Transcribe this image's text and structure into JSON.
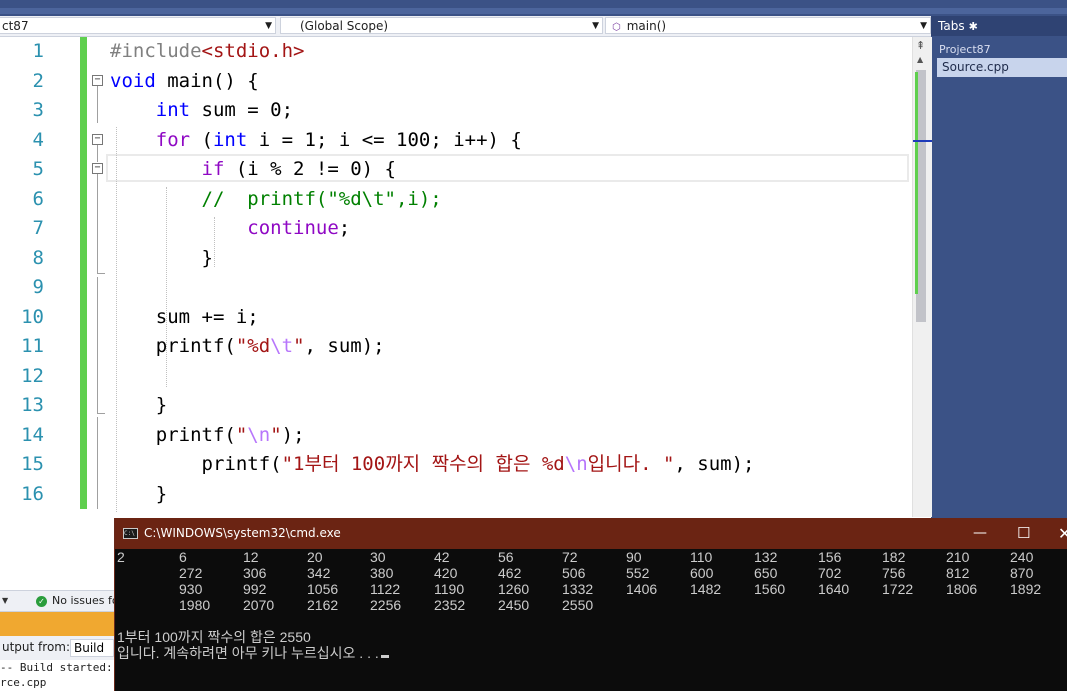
{
  "navbar": {
    "file_dropdown": "ct87",
    "scope_dropdown": "(Global Scope)",
    "function_dropdown": "main()"
  },
  "tabs_panel": {
    "title": "Tabs",
    "gear_icon": "gear-icon",
    "project": "Project87",
    "file": "Source.cpp"
  },
  "editor": {
    "line_numbers": [
      "1",
      "2",
      "3",
      "4",
      "5",
      "6",
      "7",
      "8",
      "9",
      "10",
      "11",
      "12",
      "13",
      "14",
      "15",
      "16"
    ]
  },
  "status": {
    "issues": "No issues fo"
  },
  "output": {
    "label": "utput from:",
    "source": "Build",
    "line1": "-- Build started: F",
    "line2": "rce.cpp"
  },
  "cmd": {
    "title": "C:\\WINDOWS\\system32\\cmd.exe",
    "rows": [
      [
        "2",
        "6",
        "12",
        "20",
        "30",
        "42",
        "56",
        "72",
        "90",
        "110",
        "132",
        "156",
        "182",
        "210",
        "240"
      ],
      [
        "",
        "272",
        "306",
        "342",
        "380",
        "420",
        "462",
        "506",
        "552",
        "600",
        "650",
        "702",
        "756",
        "812",
        "870"
      ],
      [
        "",
        "930",
        "992",
        "1056",
        "1122",
        "1190",
        "1260",
        "1332",
        "1406",
        "1482",
        "1560",
        "1640",
        "1722",
        "1806",
        "1892"
      ],
      [
        "",
        "1980",
        "2070",
        "2162",
        "2256",
        "2352",
        "2450",
        "2550"
      ]
    ],
    "result_line": "1부터 100까지 짝수의 합은 2550",
    "prompt_line": "입니다. 계속하려면 아무 키나 누르십시오 . . ."
  },
  "colors": {
    "accent": "#3b5286",
    "cmd_title_bar": "#6b2413",
    "change_marker": "#5fcf4e"
  }
}
